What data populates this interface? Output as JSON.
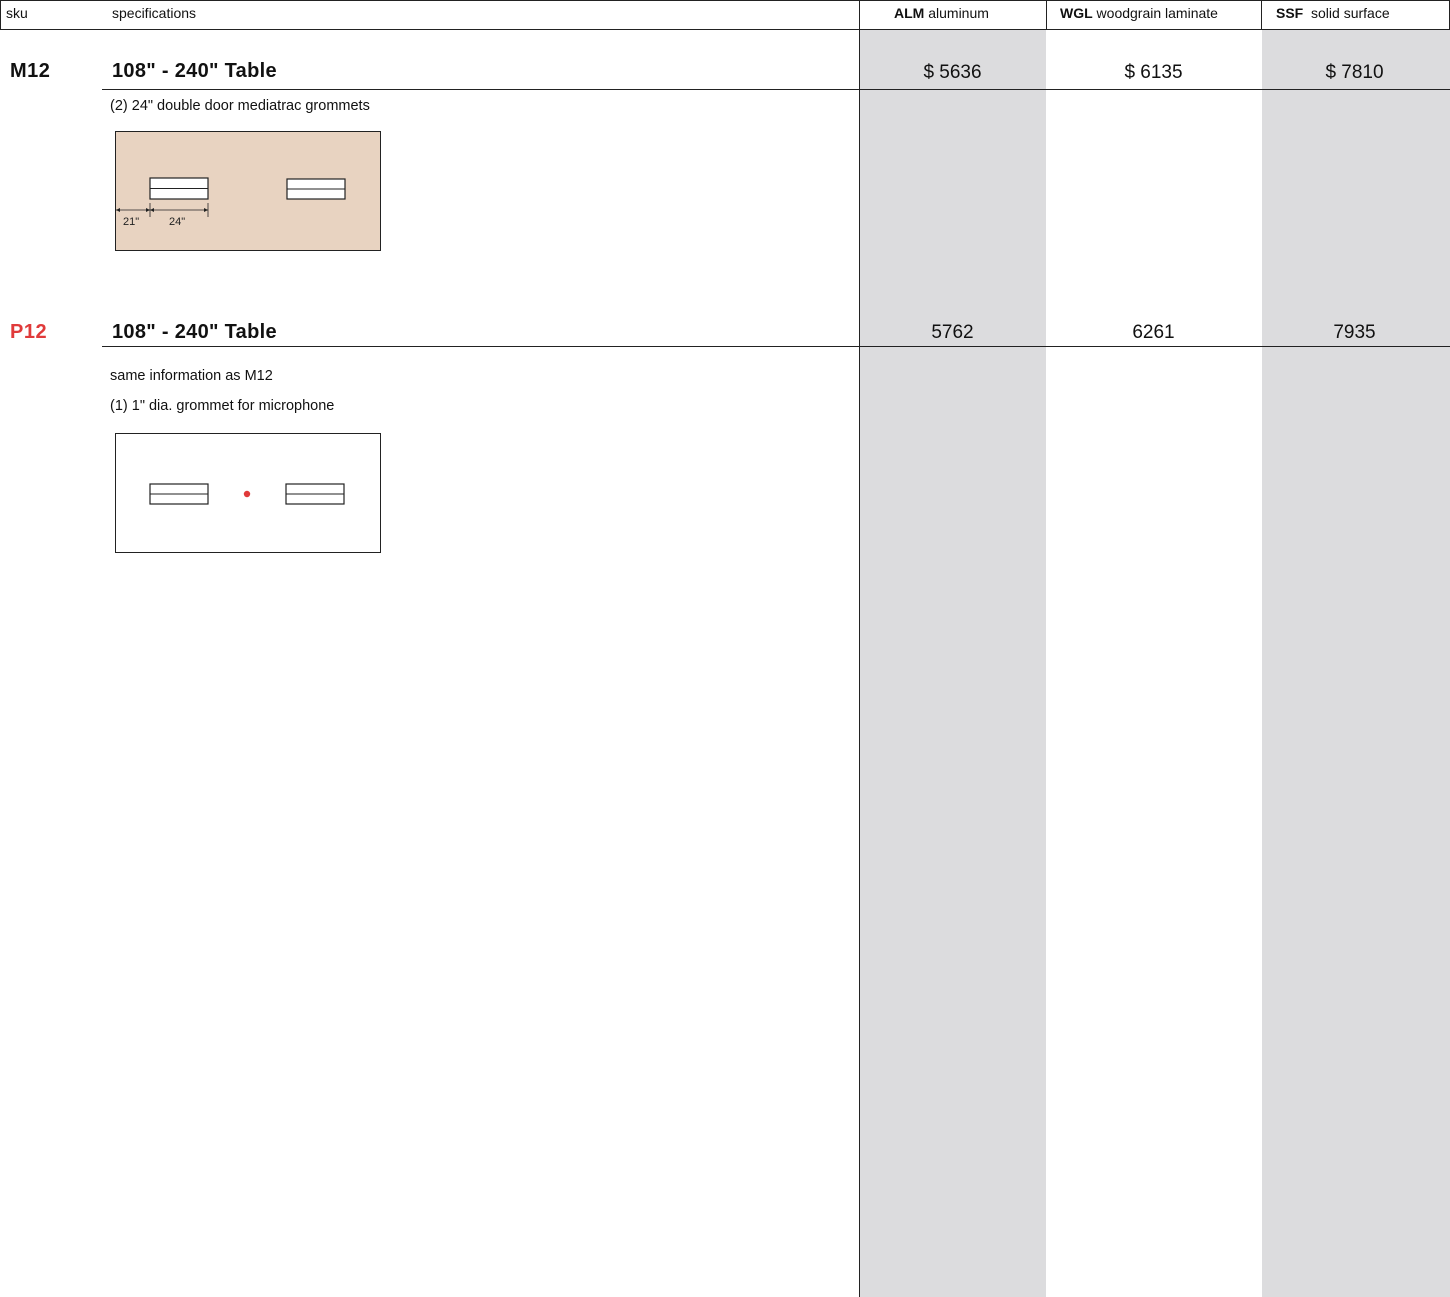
{
  "header": {
    "sku": "sku",
    "specifications": "specifications",
    "columns": [
      {
        "code": "ALM",
        "name": "aluminum"
      },
      {
        "code": "WGL",
        "name": "woodgrain laminate"
      },
      {
        "code": "SSF",
        "name": "solid surface"
      }
    ]
  },
  "items": [
    {
      "sku": "M12",
      "sku_color": "#111111",
      "title": "108\" - 240\" Table",
      "prices": [
        "$ 5636",
        "$ 6135",
        "$ 7810"
      ],
      "specs": [
        "(2) 24\" double door mediatrac grommets"
      ],
      "diagram": {
        "fill": "#e8d3c1",
        "dim_left": "21\"",
        "dim_right": "24\""
      }
    },
    {
      "sku": "P12",
      "sku_color": "#e03a3a",
      "title": "108\" - 240\" Table",
      "prices": [
        "5762",
        "6261",
        "7935"
      ],
      "specs": [
        "same information as M12",
        "(1) 1\" dia. grommet for microphone"
      ],
      "diagram": {
        "fill": "#ffffff",
        "mic_color": "#e03a3a"
      }
    }
  ]
}
